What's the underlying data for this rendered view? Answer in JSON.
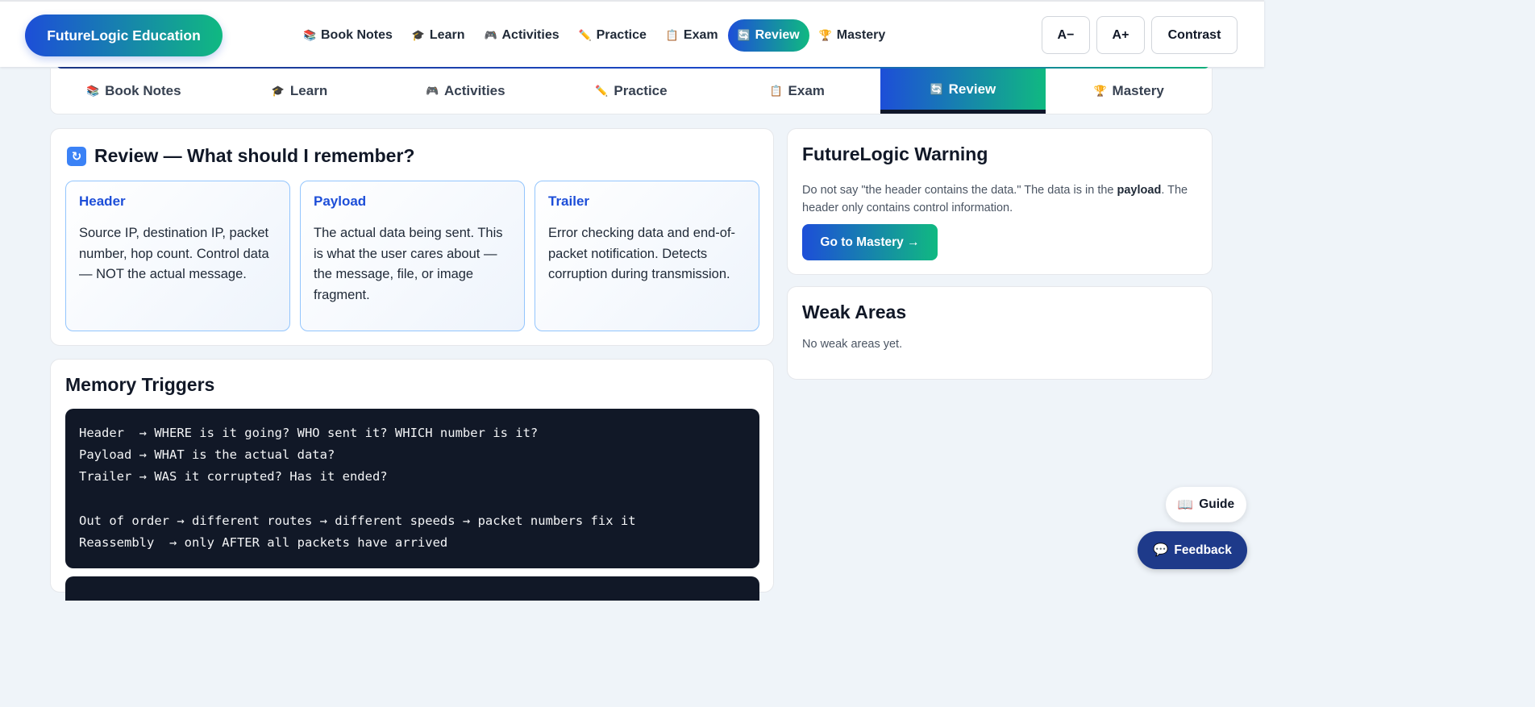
{
  "brand": "FutureLogic Education",
  "nav": [
    {
      "icon": "📚",
      "label": "Book Notes"
    },
    {
      "icon": "🎓",
      "label": "Learn"
    },
    {
      "icon": "🎮",
      "label": "Activities"
    },
    {
      "icon": "✏️",
      "label": "Practice"
    },
    {
      "icon": "📋",
      "label": "Exam"
    },
    {
      "icon": "🔄",
      "label": "Review",
      "active": true
    },
    {
      "icon": "🏆",
      "label": "Mastery"
    }
  ],
  "tools": {
    "decrease": "A−",
    "increase": "A+",
    "contrast": "Contrast"
  },
  "tabs": [
    {
      "icon": "📚",
      "label": "Book Notes"
    },
    {
      "icon": "🎓",
      "label": "Learn"
    },
    {
      "icon": "🎮",
      "label": "Activities"
    },
    {
      "icon": "✏️",
      "label": "Practice"
    },
    {
      "icon": "📋",
      "label": "Exam"
    },
    {
      "icon": "🔄",
      "label": "Review",
      "active": true
    },
    {
      "icon": "🏆",
      "label": "Mastery"
    }
  ],
  "review": {
    "icon": "🔄",
    "title": "Review — What should I remember?",
    "concepts": [
      {
        "title": "Header",
        "text": "Source IP, destination IP, packet number, hop count. Control data — NOT the actual message."
      },
      {
        "title": "Payload",
        "text": "The actual data being sent. This is what the user cares about — the message, file, or image fragment."
      },
      {
        "title": "Trailer",
        "text": "Error checking data and end-of-packet notification. Detects corruption during transmission."
      }
    ]
  },
  "warning": {
    "title": "FutureLogic Warning",
    "text_before": "Do not say \"the header contains the data.\" The data is in the ",
    "text_bold": "payload",
    "text_after": ". The header only contains control information.",
    "button": "Go to Mastery →"
  },
  "weak": {
    "title": "Weak Areas",
    "text": "No weak areas yet."
  },
  "memory": {
    "title": "Memory Triggers",
    "code": "Header  → WHERE is it going? WHO sent it? WHICH number is it?\nPayload → WHAT is the actual data?\nTrailer → WAS it corrupted? Has it ended?\n\nOut of order → different routes → different speeds → packet numbers fix it\nReassembly  → only AFTER all packets have arrived"
  },
  "floating": {
    "guide_icon": "📖",
    "guide": "Guide",
    "feedback_icon": "💬",
    "feedback": "Feedback"
  },
  "colors": {
    "primary": "#1d4ed8",
    "accent": "#10b981",
    "dark": "#111827"
  }
}
